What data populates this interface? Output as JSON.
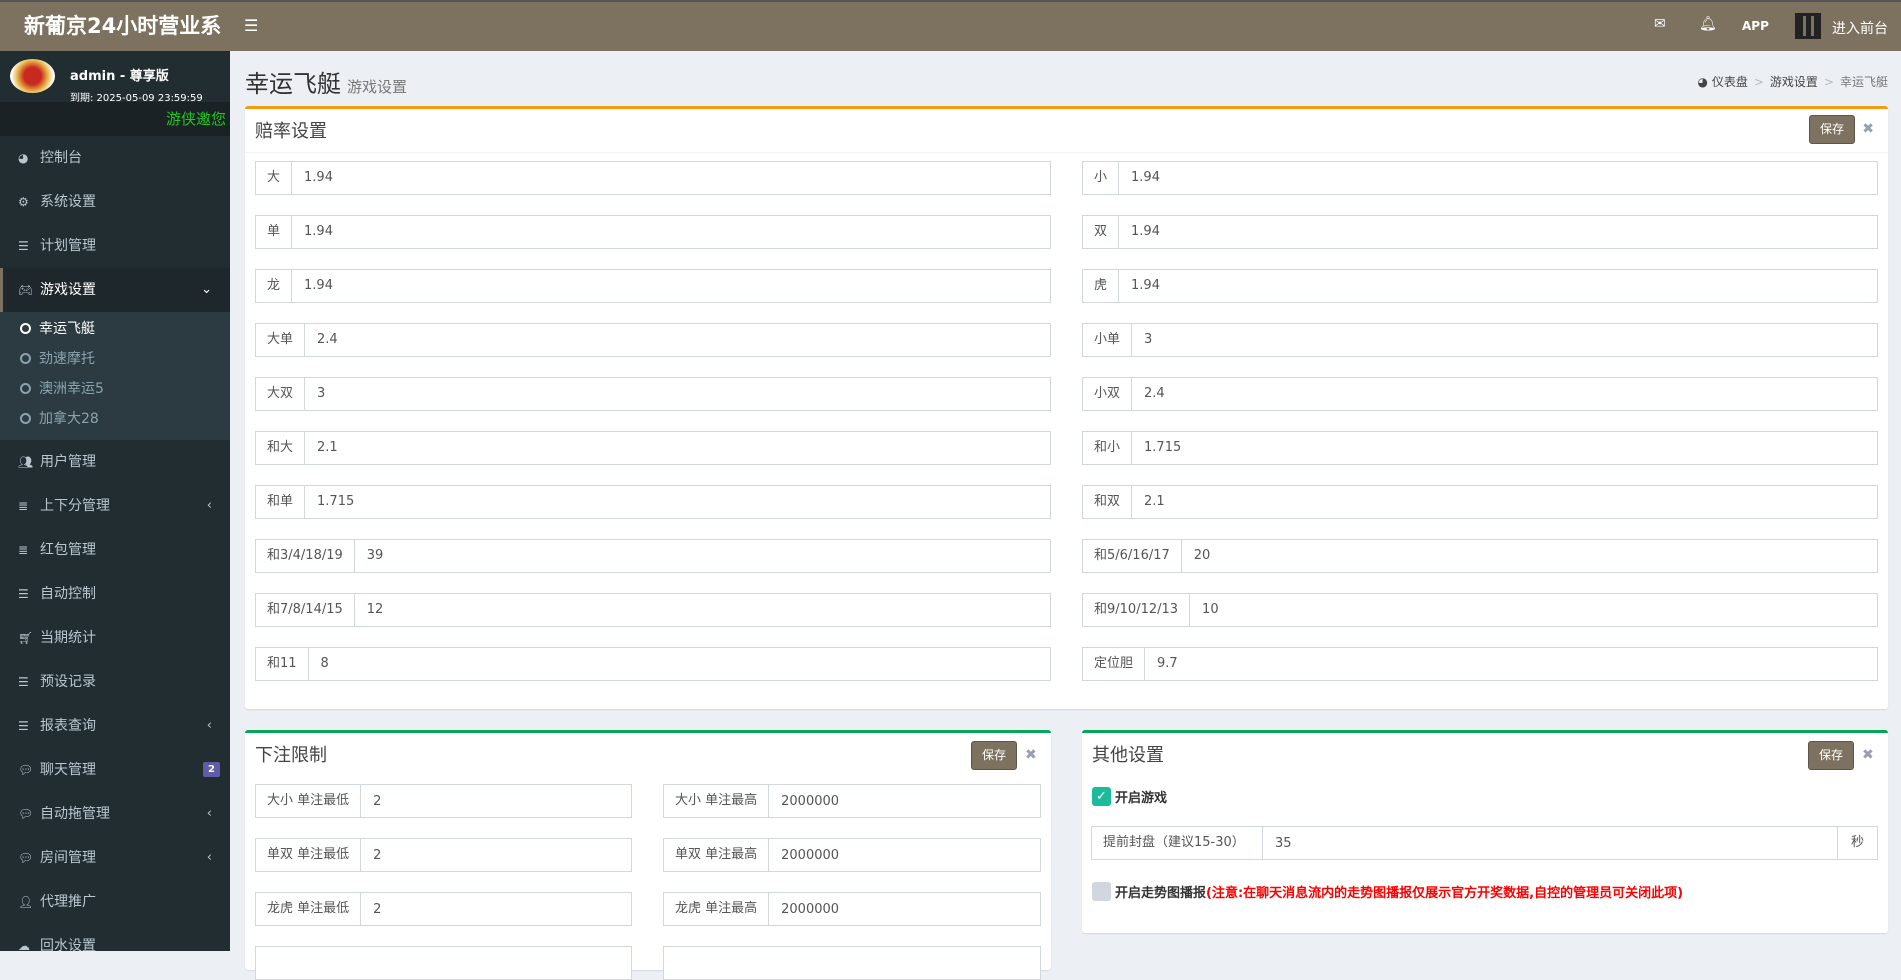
{
  "header": {
    "title": "新葡京24小时营业系",
    "menu_icon": "bars-icon",
    "mail_icon": "envelope-icon",
    "bell_icon": "bell-icon",
    "app_label": "APP",
    "qr_icon": "qrcode-icon",
    "front_label": "进入前台",
    "color": "#7d7260"
  },
  "user": {
    "name": "admin - 尊享版",
    "expire": "到期: 2025-05-09 23:59:59",
    "marquee": "游侠邀您"
  },
  "sidebar": {
    "items": [
      {
        "label": "控制台",
        "icon": "dashboard-icon"
      },
      {
        "label": "系统设置",
        "icon": "cogs-icon"
      },
      {
        "label": "计划管理",
        "icon": "list-ol-icon"
      },
      {
        "label": "游戏设置",
        "icon": "gamepad-icon",
        "active": true,
        "children": [
          {
            "label": "幸运飞艇",
            "active": true
          },
          {
            "label": "劲速摩托"
          },
          {
            "label": "澳洲幸运5"
          },
          {
            "label": "加拿大28"
          }
        ]
      },
      {
        "label": "用户管理",
        "icon": "users-icon"
      },
      {
        "label": "上下分管理",
        "icon": "database-icon",
        "arrow": true
      },
      {
        "label": "红包管理",
        "icon": "database-icon"
      },
      {
        "label": "自动控制",
        "icon": "list-icon"
      },
      {
        "label": "当期统计",
        "icon": "cart-icon"
      },
      {
        "label": "预设记录",
        "icon": "list-icon"
      },
      {
        "label": "报表查询",
        "icon": "list-ol-icon",
        "arrow": true
      },
      {
        "label": "聊天管理",
        "icon": "comments-icon",
        "badge": "2"
      },
      {
        "label": "自动拖管理",
        "icon": "commenting-icon",
        "arrow": true
      },
      {
        "label": "房间管理",
        "icon": "comments-icon",
        "arrow": true
      },
      {
        "label": "代理推广",
        "icon": "user-plus-icon"
      },
      {
        "label": "回水设置",
        "icon": "cloud-download-icon"
      }
    ]
  },
  "page": {
    "title": "幸运飞艇",
    "subtitle": "游戏设置"
  },
  "breadcrumb": [
    "仪表盘",
    "游戏设置",
    "幸运飞艇"
  ],
  "odds": {
    "title": "赔率设置",
    "save": "保存",
    "left": [
      {
        "label": "大",
        "value": "1.94"
      },
      {
        "label": "单",
        "value": "1.94"
      },
      {
        "label": "龙",
        "value": "1.94"
      },
      {
        "label": "大单",
        "value": "2.4"
      },
      {
        "label": "大双",
        "value": "3"
      },
      {
        "label": "和大",
        "value": "2.1"
      },
      {
        "label": "和单",
        "value": "1.715"
      },
      {
        "label": "和3/4/18/19",
        "value": "39"
      },
      {
        "label": "和7/8/14/15",
        "value": "12"
      },
      {
        "label": "和11",
        "value": "8"
      }
    ],
    "right": [
      {
        "label": "小",
        "value": "1.94"
      },
      {
        "label": "双",
        "value": "1.94"
      },
      {
        "label": "虎",
        "value": "1.94"
      },
      {
        "label": "小单",
        "value": "3"
      },
      {
        "label": "小双",
        "value": "2.4"
      },
      {
        "label": "和小",
        "value": "1.715"
      },
      {
        "label": "和双",
        "value": "2.1"
      },
      {
        "label": "和5/6/16/17",
        "value": "20"
      },
      {
        "label": "和9/10/12/13",
        "value": "10"
      },
      {
        "label": "定位胆",
        "value": "9.7"
      }
    ]
  },
  "limits": {
    "title": "下注限制",
    "save": "保存",
    "rows": [
      {
        "min_label": "大小 单注最低",
        "min": "2",
        "max_label": "大小 单注最高",
        "max": "2000000"
      },
      {
        "min_label": "单双 单注最低",
        "min": "2",
        "max_label": "单双 单注最高",
        "max": "2000000"
      },
      {
        "min_label": "龙虎 单注最低",
        "min": "2",
        "max_label": "龙虎 单注最高",
        "max": "2000000"
      }
    ]
  },
  "other": {
    "title": "其他设置",
    "save": "保存",
    "open_game": "开启游戏",
    "open_game_checked": true,
    "close_label": "提前封盘（建议15-30）",
    "close_value": "35",
    "close_unit": "秒",
    "trend_label": "开启走势图播报",
    "trend_checked": false,
    "trend_note": "(注意:在聊天消息流内的走势图播报仅展示官方开奖数据,自控的管理员可关闭此项)"
  }
}
